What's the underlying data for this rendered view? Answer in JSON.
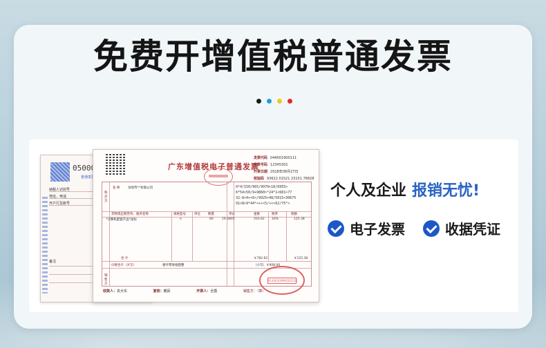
{
  "title": "免费开增值税普通发票",
  "dots": {
    "colors": [
      "#1a1a1a",
      "#1aa0e0",
      "#f5c518",
      "#e5262a"
    ]
  },
  "invoice_back": {
    "number": "05000",
    "labels": [
      "普通发票",
      "纳税人识别号",
      "地址、电话",
      "开户行及账号",
      "备注"
    ]
  },
  "invoice_front": {
    "title": "广东增值税电子普通发票",
    "stamp_top": "国家税务总局",
    "meta": [
      {
        "label": "发票代码",
        "value": "044001900111"
      },
      {
        "label": "发票号码",
        "value": "12345302"
      },
      {
        "label": "开票日期",
        "value": "2018年08月27日"
      },
      {
        "label": "校验码",
        "value": "93622 01521 23151 76828"
      }
    ],
    "buyer_label": "购买方",
    "buyer_name_label": "名 称",
    "buyer_name_value": "深圳市**有限公司",
    "seller_label": "销售方",
    "item_header": [
      "货物或应税劳务、服务名称",
      "规格型号",
      "单位",
      "数量",
      "单价",
      "金额",
      "税率",
      "税额"
    ],
    "item_name": "*计算机配套产品*鼠标",
    "item_unit": "个",
    "item_qty": "60",
    "item_price": "19.3805",
    "item_amount": "203.62",
    "item_rate": "16%",
    "item_tax": "125.38",
    "subtotal_label": "合 计",
    "subtotal_amount": "￥782.62",
    "subtotal_tax": "￥125.38",
    "total_label": "价税合计（大写）",
    "total_words": "壹仟零柒拾圆整",
    "total_small": "（小写）￥908.00",
    "cipher": [
      "9*4/150/965/9970+18/6955>",
      "6*54>50/9+9860>*24*1<681>77",
      "32-8<4+<6</9925+48/5015<30675",
      "91>8>9*44*<+<<5/<<<62/75*<"
    ],
    "stamp_big": "91440300MA5D2525",
    "footer": {
      "payee_label": "收款人：",
      "payee": "袁大东",
      "reviewer_label": "复核：",
      "reviewer": "戴民",
      "drawer_label": "开票人：",
      "drawer": "全震",
      "seller_label": "销售方：（章）"
    }
  },
  "slogan": {
    "prefix": "个人及企业",
    "highlight": "报销无忧!"
  },
  "features": [
    {
      "icon": "check-circle-icon",
      "label": "电子发票"
    },
    {
      "icon": "check-circle-icon",
      "label": "收据凭证"
    }
  ]
}
